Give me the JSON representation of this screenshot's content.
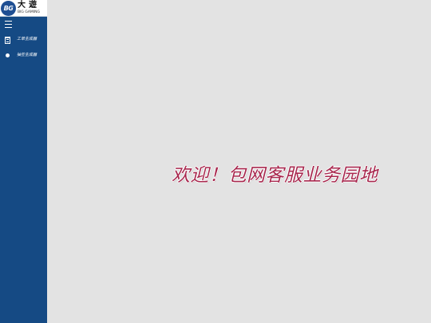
{
  "logo": {
    "badge": "BG",
    "name_cn": "大遊",
    "name_en": "BIG GAMING"
  },
  "sidebar": {
    "menu_icon": "hamburger-menu-icon",
    "items": [
      {
        "label": "工单生成器",
        "icon": "document-icon"
      },
      {
        "label": "抽签生成器",
        "icon": "dot-icon"
      }
    ]
  },
  "main": {
    "welcome": "欢迎！包网客服业务园地"
  },
  "colors": {
    "sidebar_bg": "#154a84",
    "page_bg": "#e3e3e3",
    "welcome_text": "#a8284e"
  }
}
